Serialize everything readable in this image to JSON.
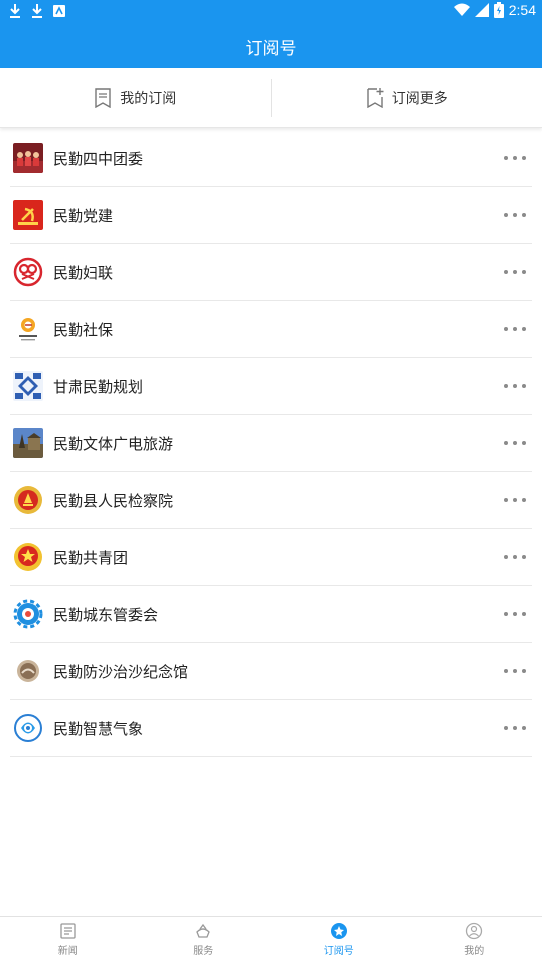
{
  "status_bar": {
    "time": "2:54"
  },
  "app_bar": {
    "title": "订阅号"
  },
  "tabs": [
    {
      "label": "我的订阅",
      "icon": "bookmark-list-icon"
    },
    {
      "label": "订阅更多",
      "icon": "bookmark-add-icon"
    }
  ],
  "subscriptions": [
    {
      "name": "民勤四中团委",
      "icon": "group-photo-icon"
    },
    {
      "name": "民勤党建",
      "icon": "party-emblem-icon"
    },
    {
      "name": "民勤妇联",
      "icon": "womens-federation-icon"
    },
    {
      "name": "民勤社保",
      "icon": "social-security-icon"
    },
    {
      "name": "甘肃民勤规划",
      "icon": "planning-logo-icon"
    },
    {
      "name": "民勤文体广电旅游",
      "icon": "landmark-photo-icon"
    },
    {
      "name": "民勤县人民检察院",
      "icon": "procuratorate-emblem-icon"
    },
    {
      "name": "民勤共青团",
      "icon": "youth-league-emblem-icon"
    },
    {
      "name": "民勤城东管委会",
      "icon": "gear-logo-icon"
    },
    {
      "name": "民勤防沙治沙纪念馆",
      "icon": "museum-seal-icon"
    },
    {
      "name": "民勤智慧气象",
      "icon": "weather-logo-icon"
    }
  ],
  "bottom_nav": [
    {
      "label": "新闻",
      "icon": "news-icon",
      "active": false
    },
    {
      "label": "服务",
      "icon": "service-icon",
      "active": false
    },
    {
      "label": "订阅号",
      "icon": "subscription-icon",
      "active": true
    },
    {
      "label": "我的",
      "icon": "profile-icon",
      "active": false
    }
  ],
  "colors": {
    "accent": "#1a95ef",
    "text": "#222222",
    "muted": "#888888"
  }
}
